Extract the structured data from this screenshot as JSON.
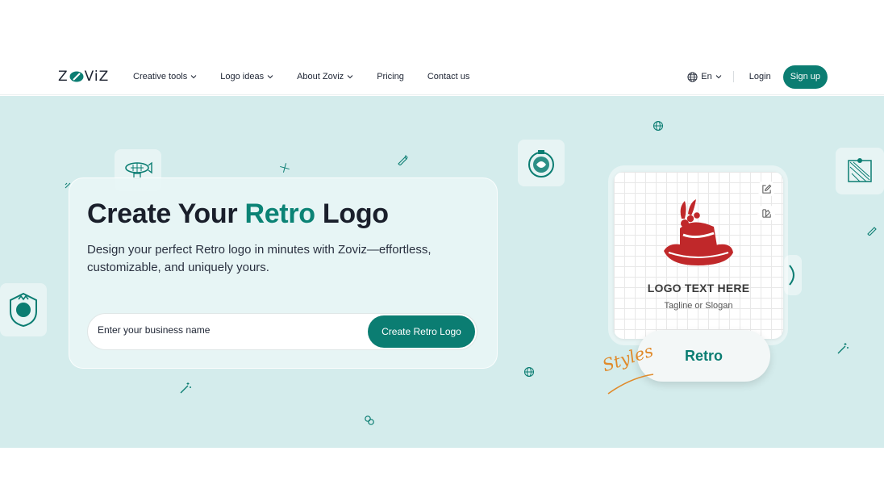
{
  "brand": {
    "logo_text_left": "Z",
    "logo_text_right": "ViZ",
    "accent": "#0b7d72"
  },
  "nav": {
    "items": [
      {
        "label": "Creative tools",
        "has_dropdown": true
      },
      {
        "label": "Logo ideas",
        "has_dropdown": true
      },
      {
        "label": "About Zoviz",
        "has_dropdown": true
      },
      {
        "label": "Pricing",
        "has_dropdown": false
      },
      {
        "label": "Contact us",
        "has_dropdown": false
      }
    ],
    "language": "En",
    "login": "Login",
    "signup": "Sign up"
  },
  "hero": {
    "title_part1": "Create Your ",
    "title_accent": "Retro",
    "title_part2": " Logo",
    "subtitle": "Design your perfect Retro logo in minutes with Zoviz—effortless, customizable, and uniquely yours.",
    "input_placeholder": "Enter your business name",
    "cta": "Create Retro Logo"
  },
  "preview": {
    "logo_text": "LOGO TEXT HERE",
    "tagline": "Tagline or Slogan",
    "style_name": "Retro",
    "styles_label": "Styles"
  },
  "icons": [
    "edit-icon",
    "palette-icon",
    "globe-icon",
    "pen-icon",
    "magic-wand-icon",
    "sparkle-icon",
    "link-icon"
  ],
  "colors": {
    "hero_bg": "#d4ecec",
    "accent": "#0b7d72",
    "title_accent": "#0b8375",
    "hat_red": "#c0282a",
    "styles_orange": "#e08a2a"
  }
}
